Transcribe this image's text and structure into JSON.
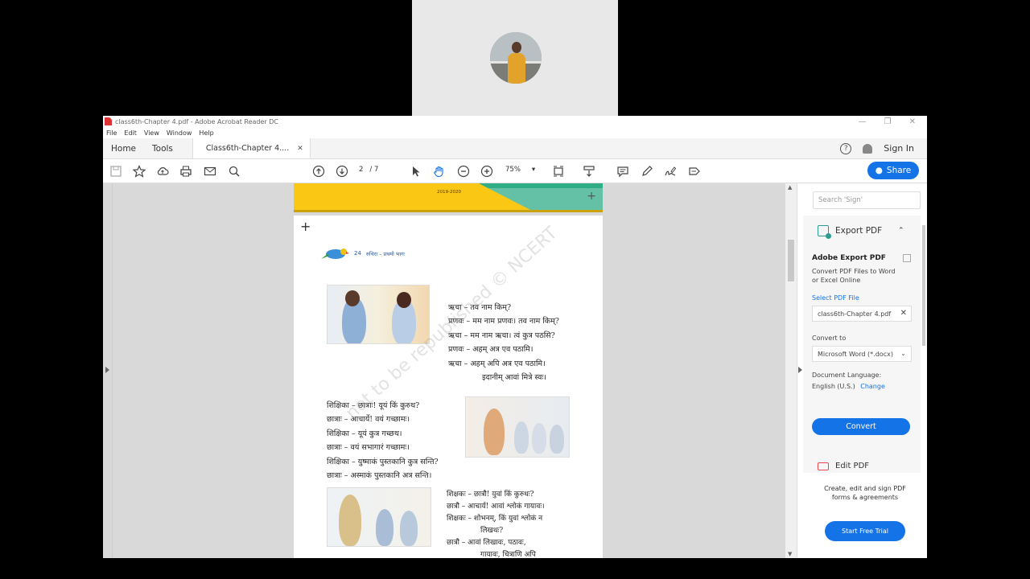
{
  "window": {
    "title": "class6th-Chapter 4.pdf - Adobe Acrobat Reader DC",
    "controls": [
      "—",
      "❐",
      "✕"
    ]
  },
  "menu": [
    "File",
    "Edit",
    "View",
    "Window",
    "Help"
  ],
  "tabs": {
    "home": "Home",
    "tools": "Tools",
    "document": "Class6th-Chapter 4....",
    "close": "✕"
  },
  "header": {
    "help": "?",
    "sign_in": "Sign In"
  },
  "toolbar": {
    "page_current": "2",
    "page_total": "/ 7",
    "zoom": "75%",
    "share": "Share"
  },
  "page": {
    "year": "2019-2020",
    "page_number": "24",
    "book_title": "रुचिरा – प्रथमो भागः",
    "dialogue1": [
      "ऋचा   – तव नाम किम्?",
      "प्रणवः – मम नाम प्रणवः। तव नाम किम्?",
      "ऋचा   – मम नाम ऋचा। त्वं कुत्र पठसि?",
      "प्रणवः – अहम् अत्र एव पठामि।",
      "ऋचा   – अहम् अपि अत्र एव पठामि।",
      "इदानीम् आवां मित्रे स्वः।"
    ],
    "dialogue2": [
      "शिक्षिका – छात्राः! यूयं किं कुरुथ?",
      "छात्राः   – आचार्ये! वयं गच्छामः।",
      "शिक्षिका – यूयं कुत्र गच्छथ।",
      "छात्राः   – वयं सभागारं गच्छामः।",
      "शिक्षिका – युष्माकं पुस्तकानि कुत्र सन्ति?",
      "छात्राः   – अस्माकं पुस्तकानि अत्र सन्ति।"
    ],
    "dialogue3": [
      "शिक्षकः – छात्रौ! युवां किं कुरुथः?",
      "छात्रौ   – आचार्य! आवां श्लोकं गायावः।",
      "शिक्षकः – शोभनम्, किं युवां श्लोकं न",
      "लिखथः?",
      "छात्रौ   – आवां लिखावः, पठावः,",
      "गायावः, चित्राणि अपि"
    ],
    "watermark": "not to be republished © NCERT"
  },
  "right_pane": {
    "search_placeholder": "Search 'Sign'",
    "export_title": "Export PDF",
    "adobe_export": "Adobe Export PDF",
    "description_line1": "Convert PDF Files to Word",
    "description_line2": "or Excel Online",
    "select_file": "Select PDF File",
    "file_name": "class6th-Chapter 4.pdf",
    "convert_to": "Convert to",
    "format": "Microsoft Word (*.docx)",
    "doc_language_label": "Document Language:",
    "doc_language": "English (U.S.)",
    "change": "Change",
    "convert_button": "Convert",
    "edit_pdf": "Edit PDF",
    "promo_line1": "Create, edit and sign PDF",
    "promo_line2": "forms & agreements",
    "trial_button": "Start Free Trial"
  },
  "colors": {
    "accent": "#1473e6",
    "banner_yellow": "#f9c714",
    "banner_green": "#2fae86"
  }
}
